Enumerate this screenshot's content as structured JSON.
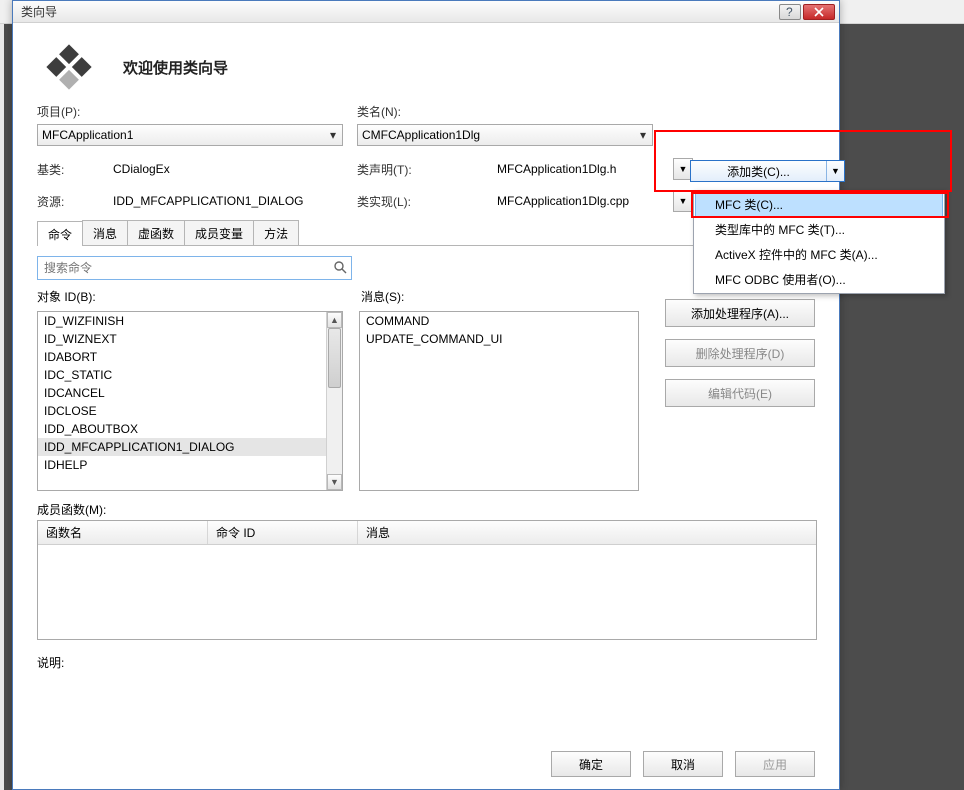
{
  "window": {
    "title": "类向导",
    "welcome": "欢迎使用类向导"
  },
  "form": {
    "project_label": "项目(P):",
    "project_value": "MFCApplication1",
    "classname_label": "类名(N):",
    "classname_value": "CMFCApplication1Dlg",
    "baseclass_label": "基类:",
    "baseclass_value": "CDialogEx",
    "classdecl_label": "类声明(T):",
    "classdecl_value": "MFCApplication1Dlg.h",
    "resource_label": "资源:",
    "resource_value": "IDD_MFCAPPLICATION1_DIALOG",
    "classimpl_label": "类实现(L):",
    "classimpl_value": "MFCApplication1Dlg.cpp"
  },
  "tabs": {
    "t0": "命令",
    "t1": "消息",
    "t2": "虚函数",
    "t3": "成员变量",
    "t4": "方法"
  },
  "search": {
    "placeholder": "搜索命令"
  },
  "objects": {
    "label": "对象 ID(B):",
    "items": [
      "ID_WIZFINISH",
      "ID_WIZNEXT",
      "IDABORT",
      "IDC_STATIC",
      "IDCANCEL",
      "IDCLOSE",
      "IDD_ABOUTBOX",
      "IDD_MFCAPPLICATION1_DIALOG",
      "IDHELP"
    ],
    "selected": "IDD_MFCAPPLICATION1_DIALOG"
  },
  "messages": {
    "label": "消息(S):",
    "items": [
      "COMMAND",
      "UPDATE_COMMAND_UI"
    ]
  },
  "sidebtns": {
    "add_handler": "添加处理程序(A)...",
    "del_handler": "删除处理程序(D)",
    "edit_code": "编辑代码(E)"
  },
  "members": {
    "label": "成员函数(M):",
    "col0": "函数名",
    "col1": "命令 ID",
    "col2": "消息"
  },
  "desc_label": "说明:",
  "footer": {
    "ok": "确定",
    "cancel": "取消",
    "apply": "应用"
  },
  "addclass": {
    "button": "添加类(C)...",
    "menu": {
      "m0": "MFC 类(C)...",
      "m1": "类型库中的 MFC 类(T)...",
      "m2": "ActiveX 控件中的 MFC 类(A)...",
      "m3": "MFC ODBC 使用者(O)..."
    }
  }
}
